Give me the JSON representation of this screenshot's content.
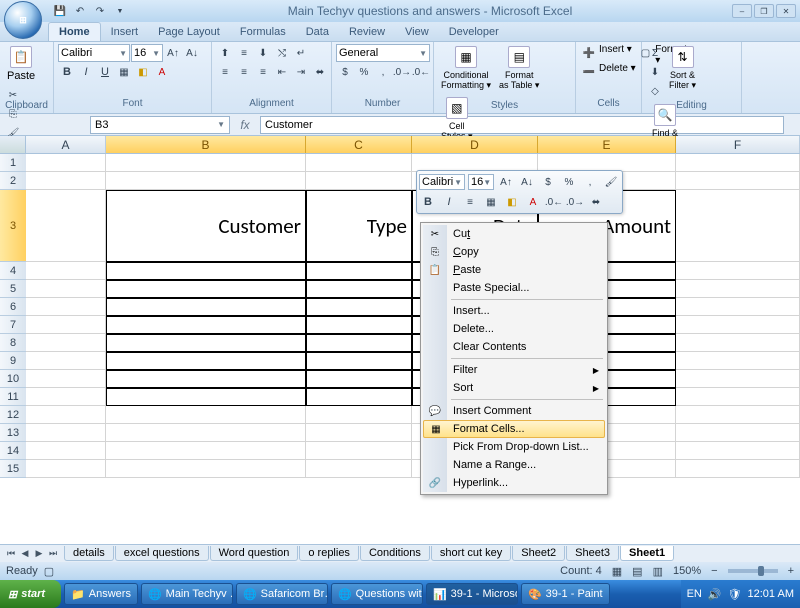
{
  "title": "Main Techyv questions and answers - Microsoft Excel",
  "tabs": [
    "Home",
    "Insert",
    "Page Layout",
    "Formulas",
    "Data",
    "Review",
    "View",
    "Developer"
  ],
  "activeTab": 0,
  "font": {
    "name": "Calibri",
    "size": "16"
  },
  "numberFormat": "General",
  "groups": {
    "clipboard": "Clipboard",
    "font": "Font",
    "align": "Alignment",
    "number": "Number",
    "styles": "Styles",
    "cells": "Cells",
    "editing": "Editing"
  },
  "bigbtns": {
    "paste": "Paste",
    "cond": "Conditional\nFormatting ▾",
    "fmttbl": "Format\nas Table ▾",
    "cellsty": "Cell\nStyles ▾",
    "sort": "Sort &\nFilter ▾",
    "find": "Find &\nSelect ▾"
  },
  "cellsMenu": {
    "insert": "Insert ▾",
    "delete": "Delete ▾",
    "format": "Format ▾"
  },
  "nameBox": "B3",
  "formula": "Customer",
  "cols": {
    "A": "A",
    "B": "B",
    "C": "C",
    "D": "D",
    "E": "E",
    "F": "F"
  },
  "headers": {
    "B": "Customer",
    "C": "Type",
    "D": "Date",
    "E": "Amount"
  },
  "sheets": [
    "details",
    "excel questions",
    "Word question",
    "o replies",
    "Conditions",
    "short cut key",
    "Sheet2",
    "Sheet3",
    "Sheet1"
  ],
  "activeSheet": 8,
  "status": {
    "ready": "Ready",
    "count": "Count: 4",
    "zoom": "150%"
  },
  "context": {
    "cut": "Cut",
    "copy": "Copy",
    "paste": "Paste",
    "pasteSpecial": "Paste Special...",
    "insert": "Insert...",
    "delete": "Delete...",
    "clear": "Clear Contents",
    "filter": "Filter",
    "sort": "Sort",
    "comment": "Insert Comment",
    "format": "Format Cells...",
    "pick": "Pick From Drop-down List...",
    "range": "Name a Range...",
    "hyperlink": "Hyperlink..."
  },
  "taskbar": {
    "start": "start",
    "items": [
      "Answers",
      "Main Techyv …",
      "Safaricom Br…",
      "Questions wit…",
      "39-1 - Microsof…",
      "39-1 - Paint"
    ],
    "lang": "EN",
    "time": "12:01 AM"
  }
}
